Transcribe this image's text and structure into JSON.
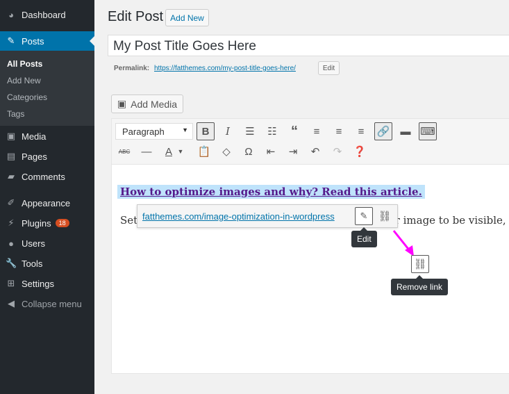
{
  "sidebar": {
    "items": [
      {
        "label": "Dashboard",
        "icon": "dashboard-icon"
      },
      {
        "label": "Posts",
        "icon": "pin-icon",
        "active": true
      },
      {
        "label": "Media",
        "icon": "media-icon"
      },
      {
        "label": "Pages",
        "icon": "pages-icon"
      },
      {
        "label": "Comments",
        "icon": "comments-icon"
      },
      {
        "label": "Appearance",
        "icon": "appearance-icon"
      },
      {
        "label": "Plugins",
        "icon": "plugins-icon",
        "badge": "18"
      },
      {
        "label": "Users",
        "icon": "users-icon"
      },
      {
        "label": "Tools",
        "icon": "tools-icon"
      },
      {
        "label": "Settings",
        "icon": "settings-icon"
      },
      {
        "label": "Collapse menu",
        "icon": "collapse-icon"
      }
    ],
    "submenu": [
      "All Posts",
      "Add New",
      "Categories",
      "Tags"
    ]
  },
  "header": {
    "title": "Edit Post",
    "add_new": "Add New"
  },
  "post": {
    "title": "My Post Title Goes Here",
    "permalink_label": "Permalink:",
    "permalink": "https://fatthemes.com/my-post-title-goes-here/",
    "edit": "Edit"
  },
  "editor": {
    "add_media": "Add Media",
    "format": "Paragraph",
    "link_text": "How to optimize images and why? Read this article.",
    "para_start": "Set",
    "para_end": "ur image to be visible, g",
    "popup_url": "fatthemes.com/image-optimization-in-wordpress",
    "tip_edit": "Edit",
    "tip_remove": "Remove link"
  },
  "colors": {
    "sidebar": "#23282d",
    "accent": "#0073aa",
    "arrow": "#ff00ff",
    "link_visited": "#551a8b"
  }
}
